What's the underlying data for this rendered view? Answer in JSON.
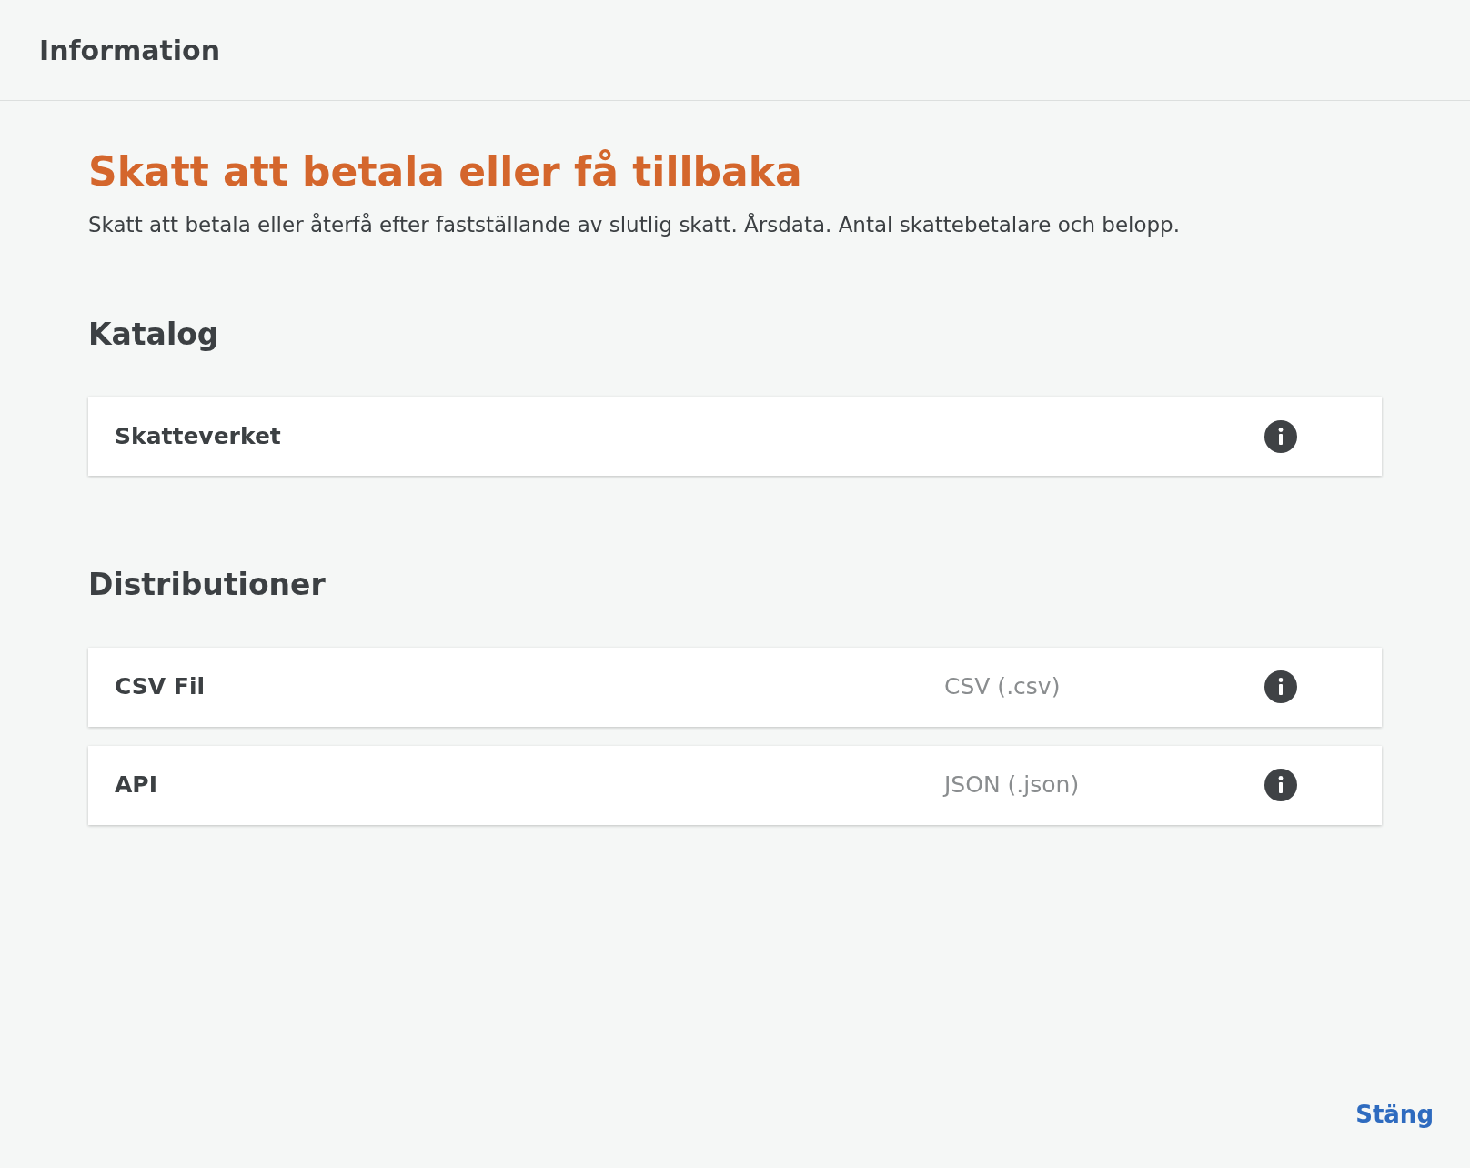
{
  "header": {
    "title": "Information"
  },
  "dataset": {
    "title": "Skatt att betala eller få tillbaka",
    "description": "Skatt att betala eller återfå efter fastställande av slutlig skatt. Årsdata. Antal skattebetalare och belopp."
  },
  "catalog": {
    "heading": "Katalog",
    "items": [
      {
        "name": "Skatteverket"
      }
    ]
  },
  "distributions": {
    "heading": "Distributioner",
    "items": [
      {
        "name": "CSV Fil",
        "format": "CSV (.csv)"
      },
      {
        "name": "API",
        "format": "JSON (.json)"
      }
    ]
  },
  "footer": {
    "close_button": "Stäng"
  }
}
